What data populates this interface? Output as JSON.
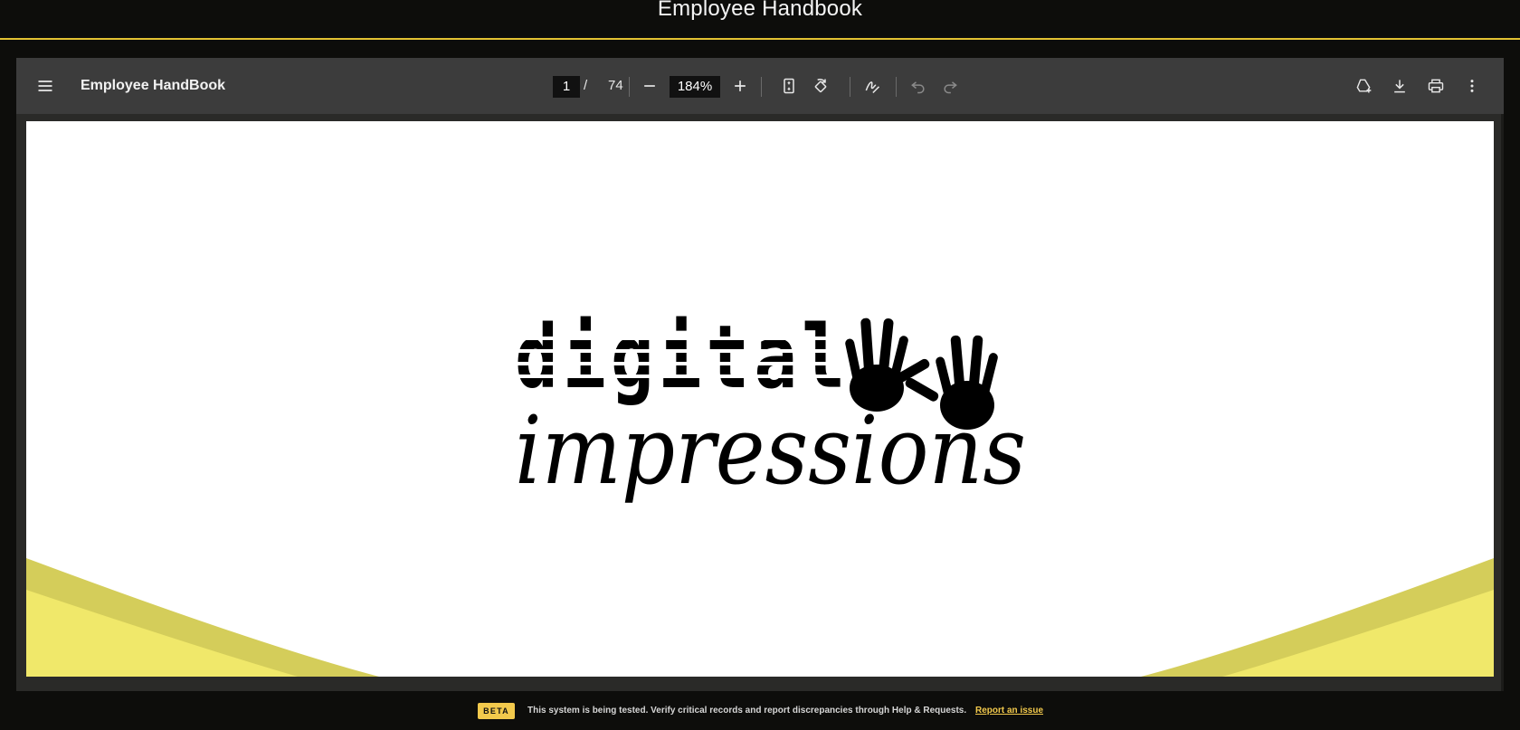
{
  "app": {
    "title": "Employee Handbook"
  },
  "viewer": {
    "document_title": "Employee HandBook",
    "current_page": "1",
    "page_separator": "/",
    "total_pages": "74",
    "zoom": "184%"
  },
  "document": {
    "logo_top": "digital",
    "logo_bottom": "impressions",
    "accent_color": "#f0e86a"
  },
  "footer": {
    "badge": "BETA",
    "message": "This system is being tested. Verify critical records and report discrepancies through Help & Requests.",
    "link": "Report an issue"
  },
  "colors": {
    "accent": "#e3c233",
    "badge": "#f2c94c",
    "toolbar": "#3c3c3c"
  },
  "icons": [
    "menu-icon",
    "zoom-out-icon",
    "zoom-in-icon",
    "fit-page-icon",
    "rotate-icon",
    "annotate-icon",
    "undo-icon",
    "redo-icon",
    "drive-add-icon",
    "download-icon",
    "print-icon",
    "more-vert-icon"
  ]
}
